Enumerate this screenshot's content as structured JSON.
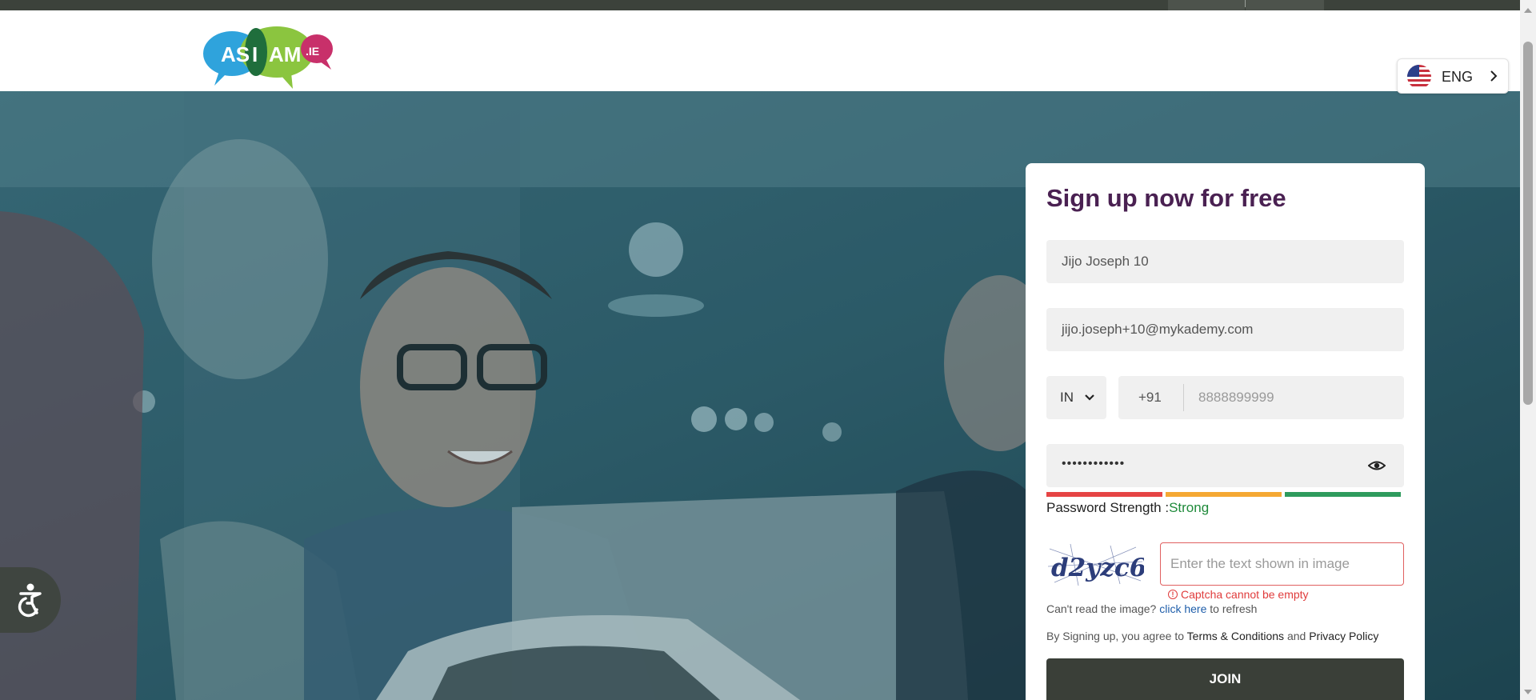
{
  "brand": {
    "logo_text_left": "AS",
    "logo_text_mid": "I",
    "logo_text_right": "AM",
    "logo_suffix": ".IE"
  },
  "language": {
    "label": "ENG",
    "flag_icon": "us-flag-icon",
    "chevron_icon": "chevron-right-icon"
  },
  "signup": {
    "title": "Sign up now for free",
    "name_value": "Jijo Joseph 10",
    "email_value": "jijo.joseph+10@mykademy.com",
    "country_value": "IN",
    "phone_code": "+91",
    "phone_value": "8888899999",
    "password_mask": "••••••••••••",
    "password_strength_label": "Password Strength :",
    "password_strength_value": "Strong",
    "captcha_image_text": "d2yzc6",
    "captcha_placeholder": "Enter the text shown in image",
    "captcha_error": "Captcha cannot be empty",
    "refresh_prefix": "Can't read the image?",
    "refresh_link": "click here",
    "refresh_suffix": "to refresh",
    "terms_prefix": "By Signing up, you agree to",
    "terms_link": "Terms & Conditions",
    "terms_and": "and",
    "privacy_link": "Privacy Policy",
    "join_label": "JOIN"
  },
  "colors": {
    "title": "#4a2152",
    "join_bg": "#3a3f38",
    "strength_weak": "#e64444",
    "strength_medium": "#f5a833",
    "strength_strong": "#2e9b5d",
    "error": "#e03c3c",
    "link": "#1f5eaa"
  },
  "icons": {
    "accessibility": "accessibility-icon",
    "eye": "eye-icon",
    "dropdown": "chevron-down-icon",
    "error": "error-circle-icon"
  }
}
